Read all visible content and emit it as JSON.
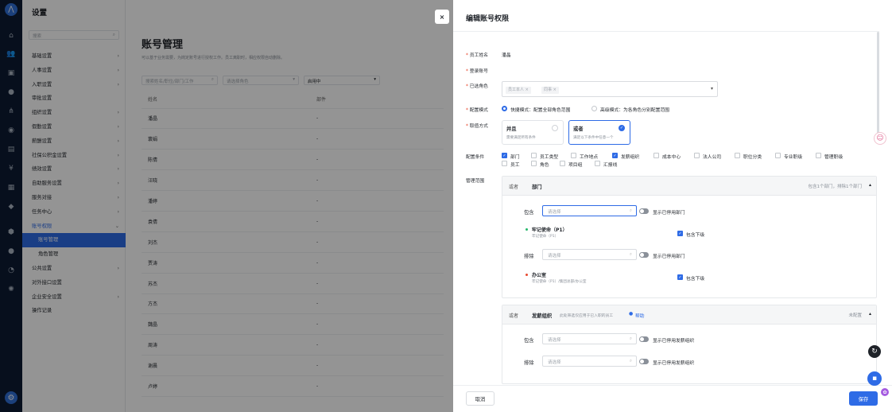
{
  "sidebar": {
    "title": "设置",
    "search_placeholder": "搜索",
    "items": [
      {
        "label": "基础设置",
        "chev": "›"
      },
      {
        "label": "人事设置",
        "chev": "›"
      },
      {
        "label": "入职设置",
        "chev": "›"
      },
      {
        "label": "审批设置",
        "chev": ""
      },
      {
        "label": "组织设置",
        "chev": "›"
      },
      {
        "label": "假勤设置",
        "chev": "›"
      },
      {
        "label": "薪酬设置",
        "chev": "›"
      },
      {
        "label": "社保公积金设置",
        "chev": "›"
      },
      {
        "label": "绩效设置",
        "chev": "›"
      },
      {
        "label": "自助服务设置",
        "chev": "›"
      },
      {
        "label": "服务对接",
        "chev": "›"
      },
      {
        "label": "任务中心",
        "chev": "›"
      },
      {
        "label": "账号权限",
        "chev": "⌄"
      },
      {
        "label": "账号管理",
        "chev": ""
      },
      {
        "label": "角色管理",
        "chev": ""
      },
      {
        "label": "公共设置",
        "chev": "›"
      },
      {
        "label": "对外接口设置",
        "chev": ""
      },
      {
        "label": "企业安全设置",
        "chev": "›"
      },
      {
        "label": "操作记录",
        "chev": ""
      }
    ]
  },
  "main": {
    "title": "账号管理",
    "desc": "可以基于业务需要，为岗定账号进行授权工作。员工离职时，相应权限自动删除。",
    "filter_search": "搜索姓名/职位/部门/工作",
    "filter_role": "请选择角色",
    "filter_status": "启用中",
    "col_name": "姓名",
    "col_dept": "部件",
    "rows": [
      "潘晶",
      "寰娟",
      "陈倩",
      "汪晓",
      "潘婷",
      "袁倩",
      "刘杰",
      "贾涛",
      "苏杰",
      "方杰",
      "魏晶",
      "周涛",
      "谢晨",
      "卢婷"
    ],
    "dash": "-"
  },
  "drawer": {
    "title": "编辑账号权限",
    "close": "×",
    "label_name": "员工姓名",
    "value_name": "潘晶",
    "label_account": "登录账号",
    "label_roles": "已选角色",
    "role_tags": [
      "员工本人 ×",
      "同事 ×"
    ],
    "label_mode": "配置模式",
    "mode_quick": "快捷模式：配置全部角色范围",
    "mode_adv": "高级模式：为各角色分别配置范围",
    "label_value_way": "取值方式",
    "card_and_title": "并且",
    "card_and_sub": "需要满足所有条件",
    "card_or_title": "或者",
    "card_or_sub": "满足以下条件中任意一个",
    "label_conditions": "配置条件",
    "conditions": [
      {
        "label": "部门",
        "on": true
      },
      {
        "label": "员工类型",
        "on": false
      },
      {
        "label": "工作地点",
        "on": false
      },
      {
        "label": "发薪组织",
        "on": true
      },
      {
        "label": "成本中心",
        "on": false
      },
      {
        "label": "法人公司",
        "on": false
      },
      {
        "label": "职位分类",
        "on": false
      },
      {
        "label": "专业职级",
        "on": false
      },
      {
        "label": "管理职级",
        "on": false
      },
      {
        "label": "员工",
        "on": false
      },
      {
        "label": "角色",
        "on": false
      },
      {
        "label": "项目组",
        "on": false
      },
      {
        "label": "汇报线",
        "on": false
      }
    ],
    "label_scope": "管理范围",
    "dept_panel": {
      "or": "或者",
      "title": "部门",
      "summary": "包含1个部门，排除1个部门",
      "include": "包含",
      "exclude": "排除",
      "placeholder": "请选择",
      "show_disabled": "显示已停用部门",
      "inc_item_name": "牢记使命（P1）",
      "inc_item_path": "牢记使命（P1）",
      "exc_item_name": "办公室",
      "exc_item_path": "牢记使命（P1）/集团总部/办公室",
      "include_sub": "包含下级"
    },
    "pay_panel": {
      "or": "或者",
      "title": "发薪组织",
      "hint": "此处筛选仅应用于已入职的员工",
      "help": "帮助",
      "summary": "未配置",
      "include": "包含",
      "exclude": "排除",
      "placeholder": "请选择",
      "show_disabled": "显示已停用发薪组织"
    },
    "cancel": "取消",
    "save": "保存"
  },
  "colors": {
    "accent": "#2e6be6",
    "rail": "#0d1b33",
    "required": "#e8492f"
  }
}
